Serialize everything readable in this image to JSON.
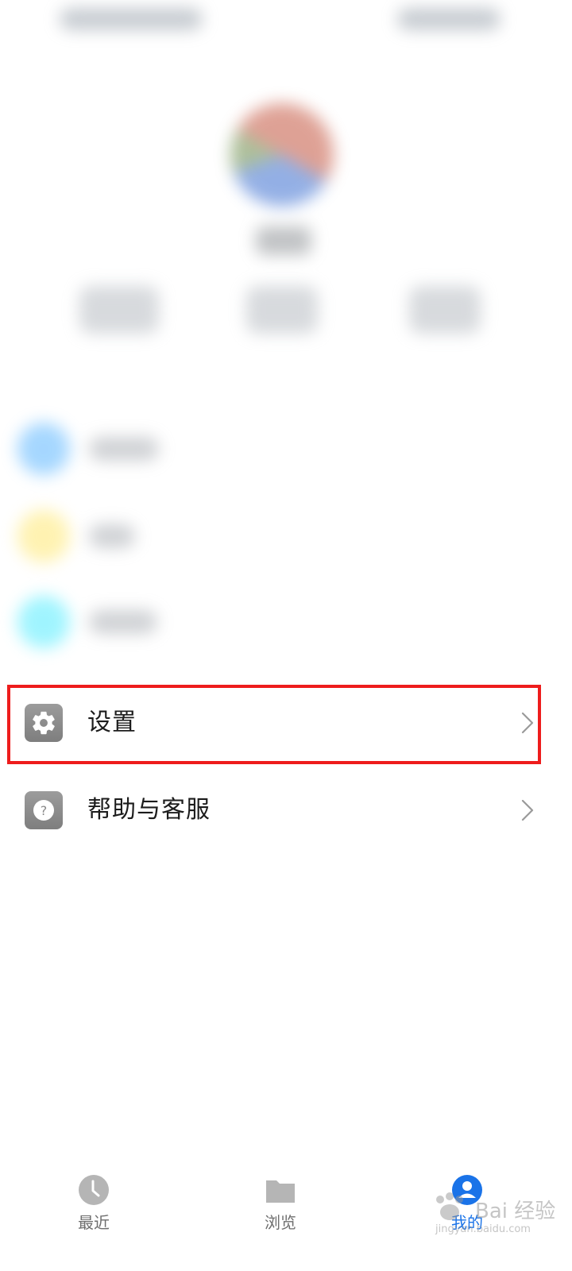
{
  "menu": {
    "settings": {
      "label": "设置",
      "icon": "gear-icon"
    },
    "help": {
      "label": "帮助与客服",
      "icon": "question-icon"
    }
  },
  "bottom_nav": {
    "items": [
      {
        "label": "最近",
        "icon": "clock-icon",
        "active": false
      },
      {
        "label": "浏览",
        "icon": "folder-icon",
        "active": false
      },
      {
        "label": "我的",
        "icon": "user-icon",
        "active": true
      }
    ]
  },
  "colors": {
    "highlight": "#ee1c1c",
    "accent": "#1a73e8",
    "icon_gray": "#8c8c8c"
  },
  "watermark": {
    "text": "Bai 经验",
    "url": "jingyan.baidu.com"
  }
}
